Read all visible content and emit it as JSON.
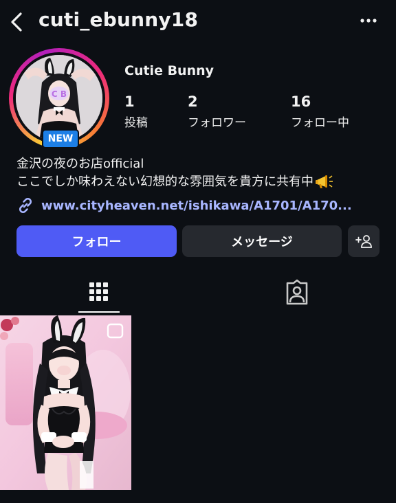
{
  "header": {
    "username": "cuti_ebunny18",
    "back_icon": "chevron-left-icon",
    "more_icon": "more-horizontal-icon"
  },
  "profile": {
    "display_name": "Cutie Bunny",
    "new_badge": "NEW",
    "stats": {
      "posts": {
        "value": "1",
        "label": "投稿"
      },
      "followers": {
        "value": "2",
        "label": "フォロワー"
      },
      "following": {
        "value": "16",
        "label": "フォロー中"
      }
    },
    "bio_line_1": "金沢の夜のお店official",
    "bio_line_2": "ここでしか味わえない幻想的な雰囲気を貴方に共有中",
    "bio_emoji": "megaphone-icon",
    "link": "www.cityheaven.net/ishikawa/A1701/A170..."
  },
  "actions": {
    "follow_label": "フォロー",
    "message_label": "メッセージ",
    "suggest_icon": "add-person-icon"
  },
  "tabs": [
    {
      "name": "posts-grid",
      "icon": "grid-icon",
      "active": true
    },
    {
      "name": "tagged",
      "icon": "tagged-person-icon",
      "active": false
    }
  ],
  "colors": {
    "background": "#0c0f14",
    "follow_button": "#4f5bf5",
    "secondary_button": "#26292f",
    "link": "#a8b6ff",
    "new_badge": "#1d7fe6"
  }
}
